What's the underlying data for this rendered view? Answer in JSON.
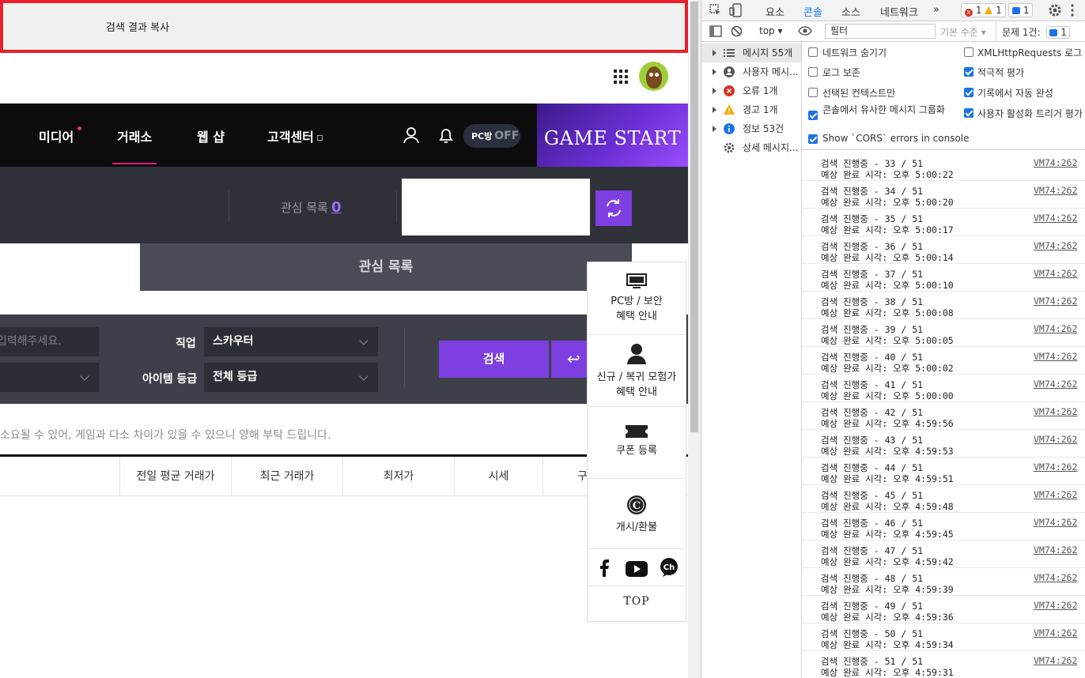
{
  "copy_bar": {
    "label": "검색 결과 복사"
  },
  "nav": {
    "items": [
      {
        "label": "미디어"
      },
      {
        "label": "거래소"
      },
      {
        "label": "웹 샵"
      },
      {
        "label": "고객센터"
      }
    ],
    "pcbang": {
      "label": "PC방",
      "state": "OFF"
    },
    "game_start": "GAME START"
  },
  "market": {
    "watchlist_label": "관심 목록",
    "watchlist_count": "0",
    "watch_tab": "관심 목록"
  },
  "search": {
    "keyword_placeholder": "입력해주세요.",
    "class_label": "직업",
    "class_value": "스카우터",
    "grade_label": "아이템 등급",
    "grade_value": "전체 등급",
    "search_button": "검색",
    "reset_icon": "↩"
  },
  "notice": "소요될 수 있어, 게임과 다소 차이가 있을 수 있으니 양해 부탁 드립니다.",
  "table": {
    "headers": [
      "전일 평균 거래가",
      "최근 거래가",
      "최저가",
      "시세",
      "구"
    ]
  },
  "quick_menu": {
    "items": [
      {
        "label1": "PC방 / 보안",
        "label2": "혜택 안내",
        "icon": "monitor-icon"
      },
      {
        "label1": "신규 / 복귀 모험가",
        "label2": "혜택 안내",
        "icon": "user-icon"
      },
      {
        "label1": "쿠폰 등록",
        "label2": "",
        "icon": "ticket-icon"
      },
      {
        "label1": "개시/환불",
        "label2": "",
        "icon": "cash-icon"
      }
    ],
    "top": "TOP"
  },
  "devtools": {
    "tabs": [
      "요소",
      "콘솔",
      "소스",
      "네트워크"
    ],
    "more": "»",
    "errors": "1",
    "warnings": "1",
    "issues_count": "1",
    "context": "top",
    "filter_value": "필터",
    "level": "기본 수준",
    "issues_label": "문제 1건:",
    "issues_badge": "1",
    "sidebar": [
      {
        "label": "메시지 55개",
        "icon": "list-icon"
      },
      {
        "label": "사용자 메시...",
        "icon": "user-icon"
      },
      {
        "label": "오류 1개",
        "icon": "error-icon"
      },
      {
        "label": "경고 1개",
        "icon": "warning-icon"
      },
      {
        "label": "정보 53건",
        "icon": "info-icon"
      },
      {
        "label": "상세 메시지...",
        "icon": "gear-icon"
      }
    ],
    "settings": {
      "hide_network": "네트워크 숨기기",
      "preserve_log": "로그 보존",
      "selected_context": "선택된 컨텍스트만",
      "group_similar": "콘솔에서 유사한 메시지 그룹화",
      "show_cors": "Show `CORS` errors in console",
      "xhr_log": "XMLHttpRequests 로그",
      "eager_eval": "적극적 평가",
      "autocomplete": "기록에서 자동 완성",
      "user_gesture": "사용자 활성화 트리거 평가"
    },
    "logs": [
      {
        "line1": "검색 진행중 - 33 / 51",
        "line2": "예상 완료 시각: 오후 5:00:22",
        "src": "VM74:262"
      },
      {
        "line1": "검색 진행중 - 34 / 51",
        "line2": "예상 완료 시각: 오후 5:00:20",
        "src": "VM74:262"
      },
      {
        "line1": "검색 진행중 - 35 / 51",
        "line2": "예상 완료 시각: 오후 5:00:17",
        "src": "VM74:262"
      },
      {
        "line1": "검색 진행중 - 36 / 51",
        "line2": "예상 완료 시각: 오후 5:00:14",
        "src": "VM74:262"
      },
      {
        "line1": "검색 진행중 - 37 / 51",
        "line2": "예상 완료 시각: 오후 5:00:10",
        "src": "VM74:262"
      },
      {
        "line1": "검색 진행중 - 38 / 51",
        "line2": "예상 완료 시각: 오후 5:00:08",
        "src": "VM74:262"
      },
      {
        "line1": "검색 진행중 - 39 / 51",
        "line2": "예상 완료 시각: 오후 5:00:05",
        "src": "VM74:262"
      },
      {
        "line1": "검색 진행중 - 40 / 51",
        "line2": "예상 완료 시각: 오후 5:00:02",
        "src": "VM74:262"
      },
      {
        "line1": "검색 진행중 - 41 / 51",
        "line2": "예상 완료 시각: 오후 5:00:00",
        "src": "VM74:262"
      },
      {
        "line1": "검색 진행중 - 42 / 51",
        "line2": "예상 완료 시각: 오후 4:59:56",
        "src": "VM74:262"
      },
      {
        "line1": "검색 진행중 - 43 / 51",
        "line2": "예상 완료 시각: 오후 4:59:53",
        "src": "VM74:262"
      },
      {
        "line1": "검색 진행중 - 44 / 51",
        "line2": "예상 완료 시각: 오후 4:59:51",
        "src": "VM74:262"
      },
      {
        "line1": "검색 진행중 - 45 / 51",
        "line2": "예상 완료 시각: 오후 4:59:48",
        "src": "VM74:262"
      },
      {
        "line1": "검색 진행중 - 46 / 51",
        "line2": "예상 완료 시각: 오후 4:59:45",
        "src": "VM74:262"
      },
      {
        "line1": "검색 진행중 - 47 / 51",
        "line2": "예상 완료 시각: 오후 4:59:42",
        "src": "VM74:262"
      },
      {
        "line1": "검색 진행중 - 48 / 51",
        "line2": "예상 완료 시각: 오후 4:59:39",
        "src": "VM74:262"
      },
      {
        "line1": "검색 진행중 - 49 / 51",
        "line2": "예상 완료 시각: 오후 4:59:36",
        "src": "VM74:262"
      },
      {
        "line1": "검색 진행중 - 50 / 51",
        "line2": "예상 완료 시각: 오후 4:59:34",
        "src": "VM74:262"
      },
      {
        "line1": "검색 진행중 - 51 / 51",
        "line2": "예상 완료 시각: 오후 4:59:31",
        "src": "VM74:262"
      }
    ]
  }
}
